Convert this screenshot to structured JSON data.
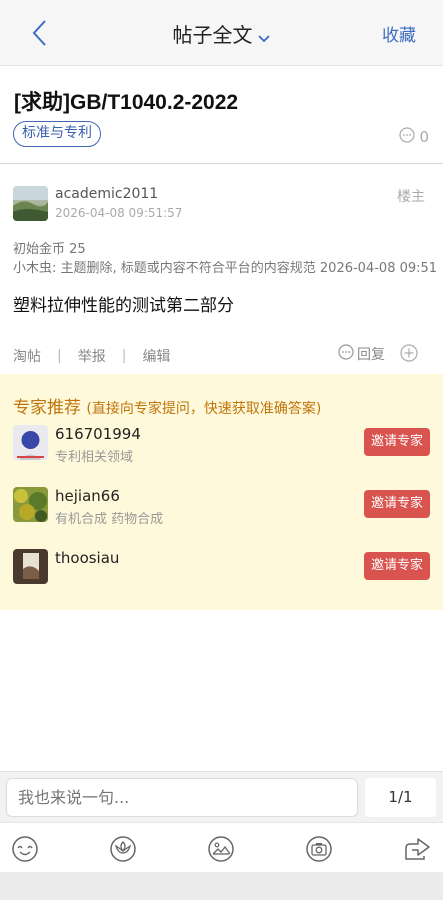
{
  "nav": {
    "title": "帖子全文",
    "right_label": "收藏"
  },
  "post": {
    "title": "[求助]GB/T1040.2-2022",
    "tag": "标准与专利",
    "comment_count": "0"
  },
  "floor": {
    "username": "academic2011",
    "time": "2026-04-08 09:51:57",
    "role": "楼主",
    "gold": "初始金币 25",
    "mod_note": "小木虫: 主题删除, 标题或内容不符合平台的内容规范 2026-04-08 09:51",
    "content": "塑料拉伸性能的测试第二部分",
    "actions": [
      "淘帖",
      "举报",
      "编辑"
    ],
    "reply_label": "回复"
  },
  "experts": {
    "title": "专家推荐",
    "subtitle": "(直接向专家提问，快速获取准确答案)",
    "invite_label": "邀请专家",
    "items": [
      {
        "name": "616701994",
        "field": "专利相关领域"
      },
      {
        "name": "hejian66",
        "field": "有机合成    药物合成"
      },
      {
        "name": "thoosiau",
        "field": ""
      }
    ]
  },
  "bottom": {
    "placeholder": "我也来说一句...",
    "page": "1/1"
  },
  "colors": {
    "accent_blue": "#3d6cc3",
    "expert_orange": "#c0750b",
    "invite_red": "#d9534f",
    "expert_bg": "#fff9dc"
  },
  "icons": [
    "back-icon",
    "chevron-down-icon",
    "comment-icon",
    "reply-icon",
    "plus-circle-icon",
    "emoji-icon",
    "flower-icon",
    "image-icon",
    "camera-icon",
    "share-icon"
  ]
}
